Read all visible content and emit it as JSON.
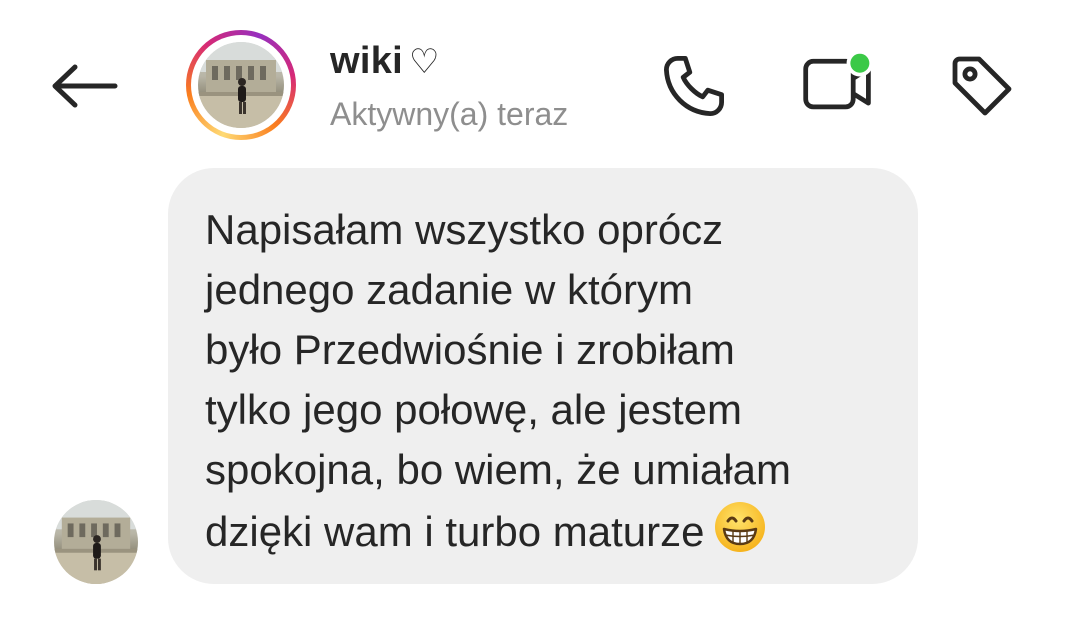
{
  "header": {
    "contact_name": "wiki",
    "name_suffix": "♡",
    "status": "Aktywny(a) teraz"
  },
  "icons": {
    "back": "arrow-left-icon",
    "call": "phone-icon",
    "video": "video-camera-icon",
    "tag": "tag-icon",
    "online_dot_color": "#3bc947",
    "emoji": "grinning-face-with-smiling-eyes"
  },
  "message": {
    "lines": [
      "Napisałam wszystko oprócz",
      "jednego zadanie w którym",
      "było Przedwiośnie i zrobiłam",
      "tylko jego połowę, ale jestem",
      "spokojna, bo wiem, że umiałam",
      "dzięki wam i turbo maturze"
    ],
    "bubble_color": "#efefef"
  },
  "colors": {
    "text": "#262626",
    "secondary_text": "#8e8e8e",
    "story_ring": [
      "#feda75",
      "#fa7e1e",
      "#d62976",
      "#962fbf"
    ]
  }
}
